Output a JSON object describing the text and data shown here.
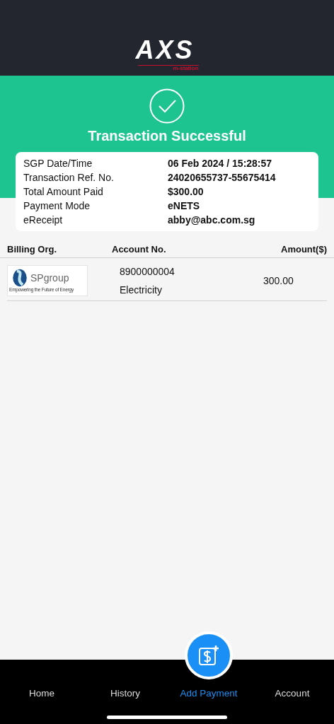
{
  "header": {
    "logo_text": "AXS",
    "logo_subtext": "m-station"
  },
  "banner": {
    "title": "Transaction Successful"
  },
  "details": [
    {
      "label": "SGP Date/Time",
      "value": "06 Feb 2024 / 15:28:57"
    },
    {
      "label": "Transaction Ref. No.",
      "value": "24020655737-55675414"
    },
    {
      "label": "Total Amount Paid",
      "value": "$300.00"
    },
    {
      "label": "Payment Mode",
      "value": "eNETS"
    },
    {
      "label": "eReceipt",
      "value": "abby@abc.com.sg"
    }
  ],
  "table": {
    "columns": [
      "Billing Org.",
      "Account No.",
      "Amount($)"
    ],
    "rows": [
      {
        "org_logo": {
          "name": "SPgroup",
          "tagline": "Empowering the Future of Energy"
        },
        "account_no": "8900000004",
        "type": "Electricity",
        "amount": "300.00"
      }
    ]
  },
  "nav": [
    {
      "label": "Home",
      "selected": false
    },
    {
      "label": "History",
      "selected": false
    },
    {
      "label": "Add Payment",
      "selected": true
    },
    {
      "label": "Account",
      "selected": false
    }
  ]
}
